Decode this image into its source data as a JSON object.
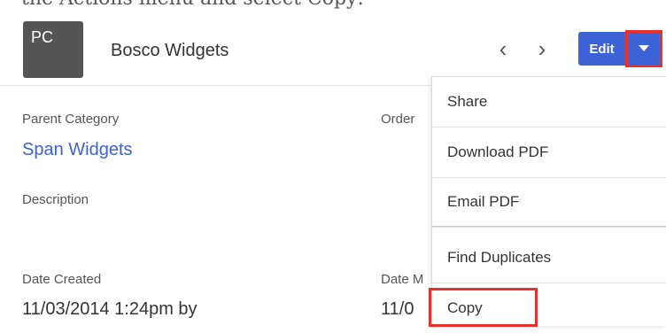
{
  "record": {
    "avatar_initials": "PC",
    "name": "Bosco Widgets"
  },
  "header": {
    "prev_glyph": "‹",
    "next_glyph": "›",
    "edit_label": "Edit"
  },
  "fields": {
    "parent_category_label": "Parent Category",
    "parent_category_value": "Span Widgets",
    "order_label": "Order",
    "description_label": "Description",
    "date_created_label": "Date Created",
    "date_created_value": "11/03/2014 1:24pm by",
    "date_modified_label": "Date M",
    "date_modified_value": "11/0"
  },
  "menu": {
    "items": [
      {
        "label": "Share"
      },
      {
        "label": "Download PDF"
      },
      {
        "label": "Email PDF"
      },
      {
        "label": "Find Duplicates"
      },
      {
        "label": "Copy"
      }
    ]
  },
  "annotation": {
    "clipped_instruction_text": "the Actions menu and select Copy:"
  },
  "colors": {
    "accent": "#3c62d6",
    "highlight": "#e8302f",
    "avatar": "#555555"
  },
  "icons": {
    "prev": "chevron-left-icon",
    "next": "chevron-right-icon",
    "actions": "caret-down-icon"
  }
}
